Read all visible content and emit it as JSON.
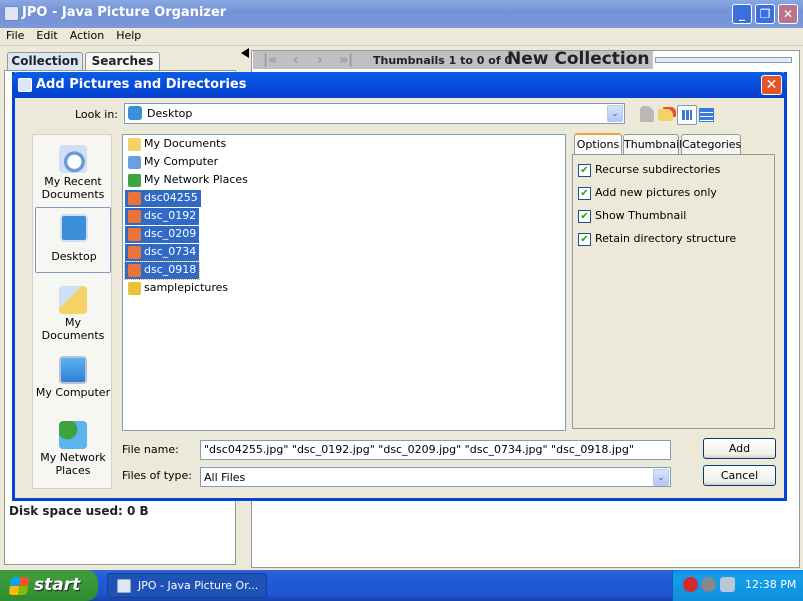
{
  "main_window": {
    "title": "JPO - Java Picture Organizer",
    "menu": [
      "File",
      "Edit",
      "Action",
      "Help"
    ],
    "left_tabs": [
      "Collection",
      "Searches"
    ],
    "disk_space": "Disk space used: 0 B",
    "nav_text": "Thumbnails 1 to 0 of 0",
    "collection_title": "New Collection"
  },
  "dialog": {
    "title": "Add Pictures and Directories",
    "look_in_label": "Look in:",
    "look_in_value": "Desktop",
    "places": [
      "My Recent Documents",
      "Desktop",
      "My Documents",
      "My Computer",
      "My Network Places"
    ],
    "files": [
      {
        "name": "My Documents",
        "type": "folder",
        "selected": false
      },
      {
        "name": "My Computer",
        "type": "computer",
        "selected": false
      },
      {
        "name": "My Network Places",
        "type": "network",
        "selected": false
      },
      {
        "name": "dsc04255",
        "type": "image",
        "selected": true
      },
      {
        "name": "dsc_0192",
        "type": "image",
        "selected": true
      },
      {
        "name": "dsc_0209",
        "type": "image",
        "selected": true
      },
      {
        "name": "dsc_0734",
        "type": "image",
        "selected": true
      },
      {
        "name": "dsc_0918",
        "type": "image",
        "selected": true
      },
      {
        "name": "samplepictures",
        "type": "zip-folder",
        "selected": false
      }
    ],
    "accessory_tabs": [
      "Options",
      "Thumbnail",
      "Categories"
    ],
    "options": [
      {
        "label": "Recurse subdirectories",
        "checked": true
      },
      {
        "label": "Add new pictures only",
        "checked": true
      },
      {
        "label": "Show Thumbnail",
        "checked": true
      },
      {
        "label": "Retain directory structure",
        "checked": true
      }
    ],
    "file_name_label": "File name:",
    "file_name_value": "\"dsc04255.jpg\" \"dsc_0192.jpg\" \"dsc_0209.jpg\" \"dsc_0734.jpg\" \"dsc_0918.jpg\"",
    "file_type_label": "Files of type:",
    "file_type_value": "All Files",
    "add_label": "Add",
    "cancel_label": "Cancel",
    "close_glyph": "✕",
    "dropdown_glyph": "⌄"
  },
  "taskbar": {
    "start_label": "start",
    "task_label": "JPO - Java Picture Or...",
    "clock": "12:38 PM"
  }
}
